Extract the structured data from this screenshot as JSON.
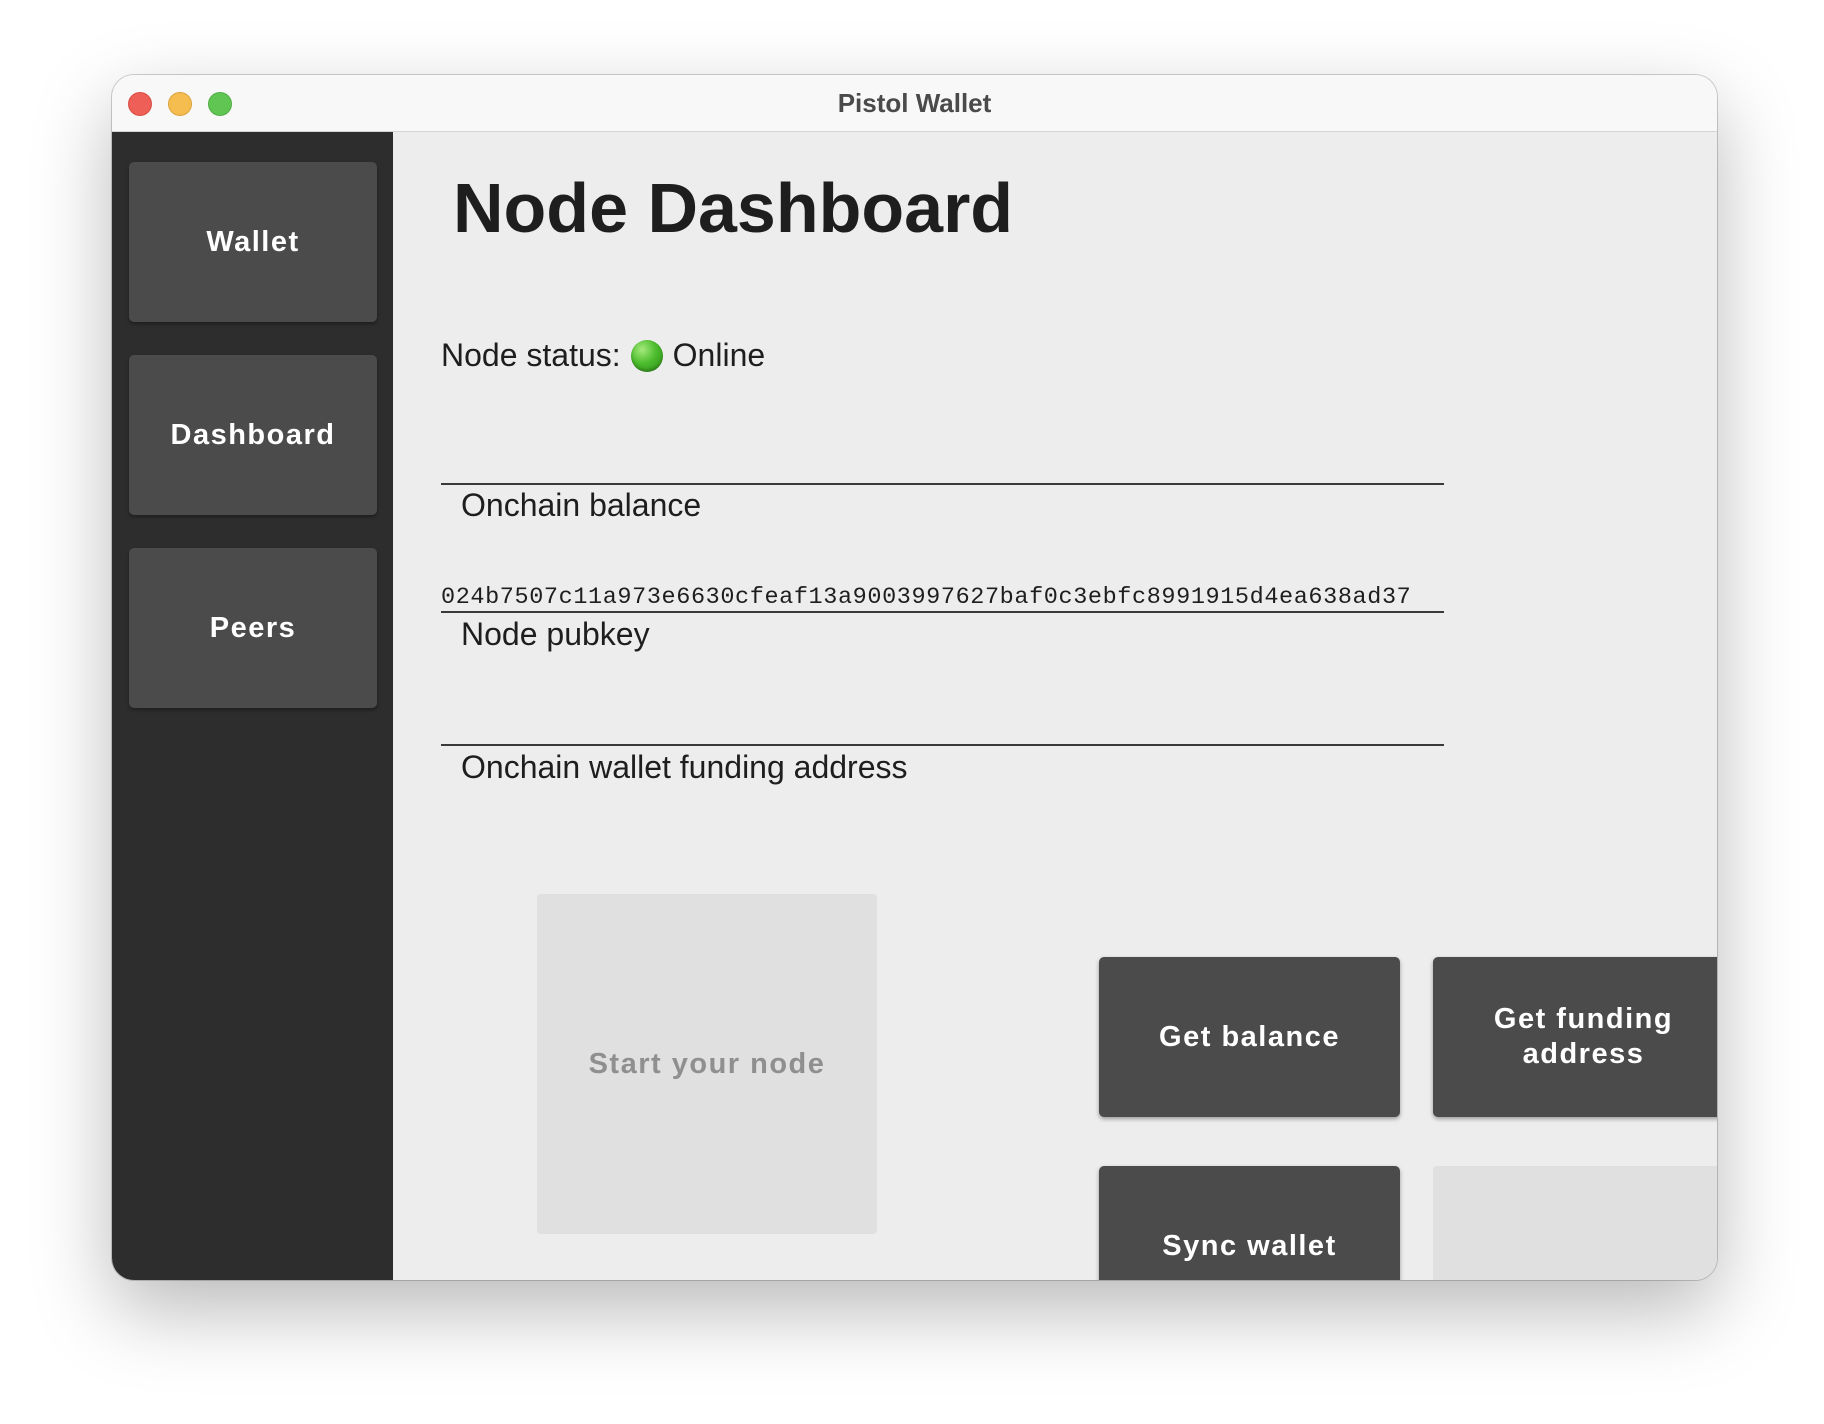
{
  "window": {
    "title": "Pistol Wallet"
  },
  "sidebar": {
    "items": [
      {
        "label": "Wallet"
      },
      {
        "label": "Dashboard"
      },
      {
        "label": "Peers"
      }
    ]
  },
  "main": {
    "title": "Node Dashboard",
    "status": {
      "label": "Node status:",
      "value": "Online",
      "indicator_color": "#4dbd2e",
      "indicator_icon": "green-circle-icon"
    },
    "fields": {
      "onchain_balance": {
        "label": "Onchain balance",
        "value": ""
      },
      "node_pubkey": {
        "label": "Node pubkey",
        "value": "024b7507c11a973e6630cfeaf13a9003997627baf0c3ebfc8991915d4ea638ad37"
      },
      "funding_address": {
        "label": "Onchain wallet funding address",
        "value": ""
      }
    },
    "buttons": {
      "start_node": "Start your node",
      "get_balance": "Get balance",
      "get_funding_address": "Get funding address",
      "sync_wallet": "Sync wallet"
    }
  },
  "colors": {
    "sidebar_bg": "#2d2d2d",
    "button_bg": "#4b4b4b",
    "content_bg": "#ededed",
    "disabled_bg": "#e0e0e0"
  }
}
